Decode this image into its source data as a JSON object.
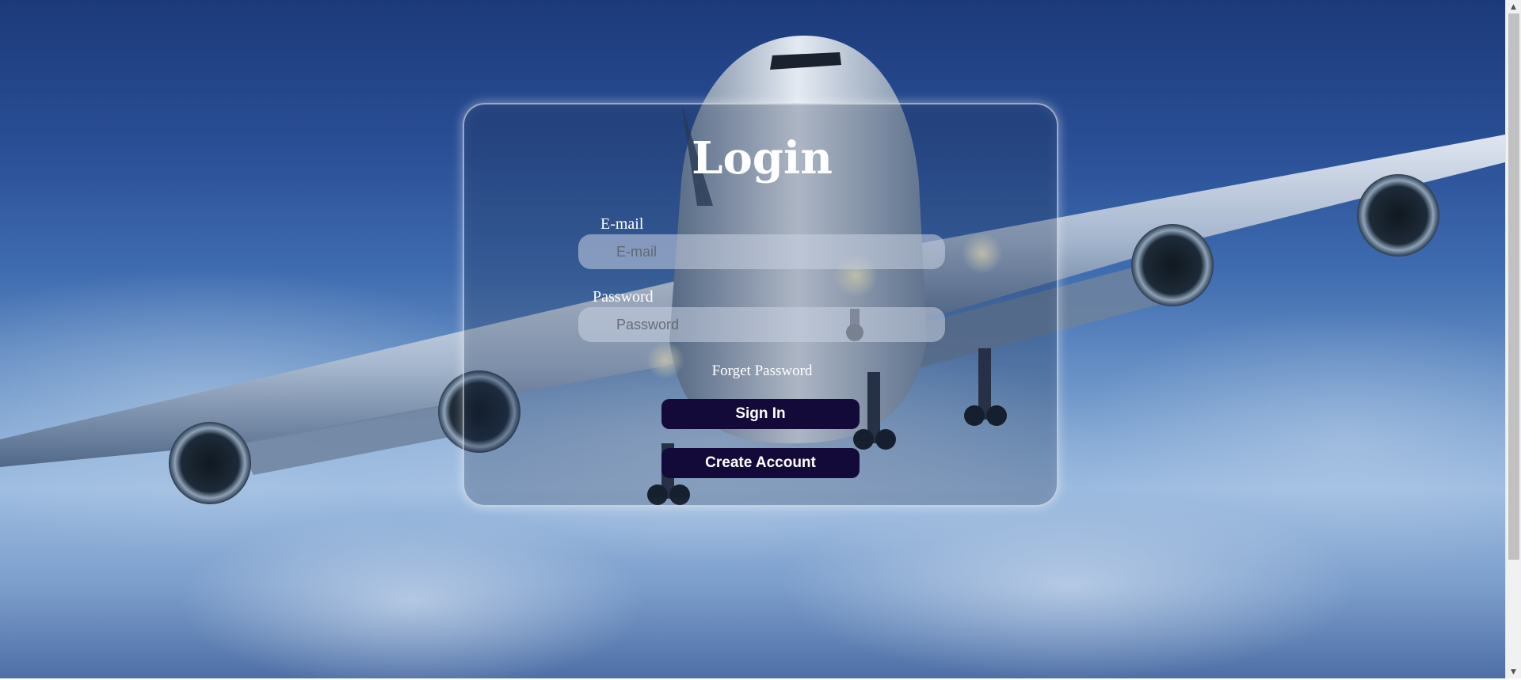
{
  "login": {
    "title": "Login",
    "email_label": "E-mail",
    "email_placeholder": "E-mail",
    "email_value": "",
    "password_label": "Password",
    "password_placeholder": "Password",
    "password_value": "",
    "forget_password_label": "Forget Password",
    "sign_in_label": "Sign In",
    "create_account_label": "Create Account"
  },
  "scrollbar": {
    "up_icon": "scroll-up-arrow-icon",
    "down_icon": "scroll-down-arrow-icon"
  },
  "colors": {
    "button_background": "#140a3a",
    "card_border": "#ffffff",
    "text": "#ffffff",
    "sky": "#2a4f96"
  }
}
